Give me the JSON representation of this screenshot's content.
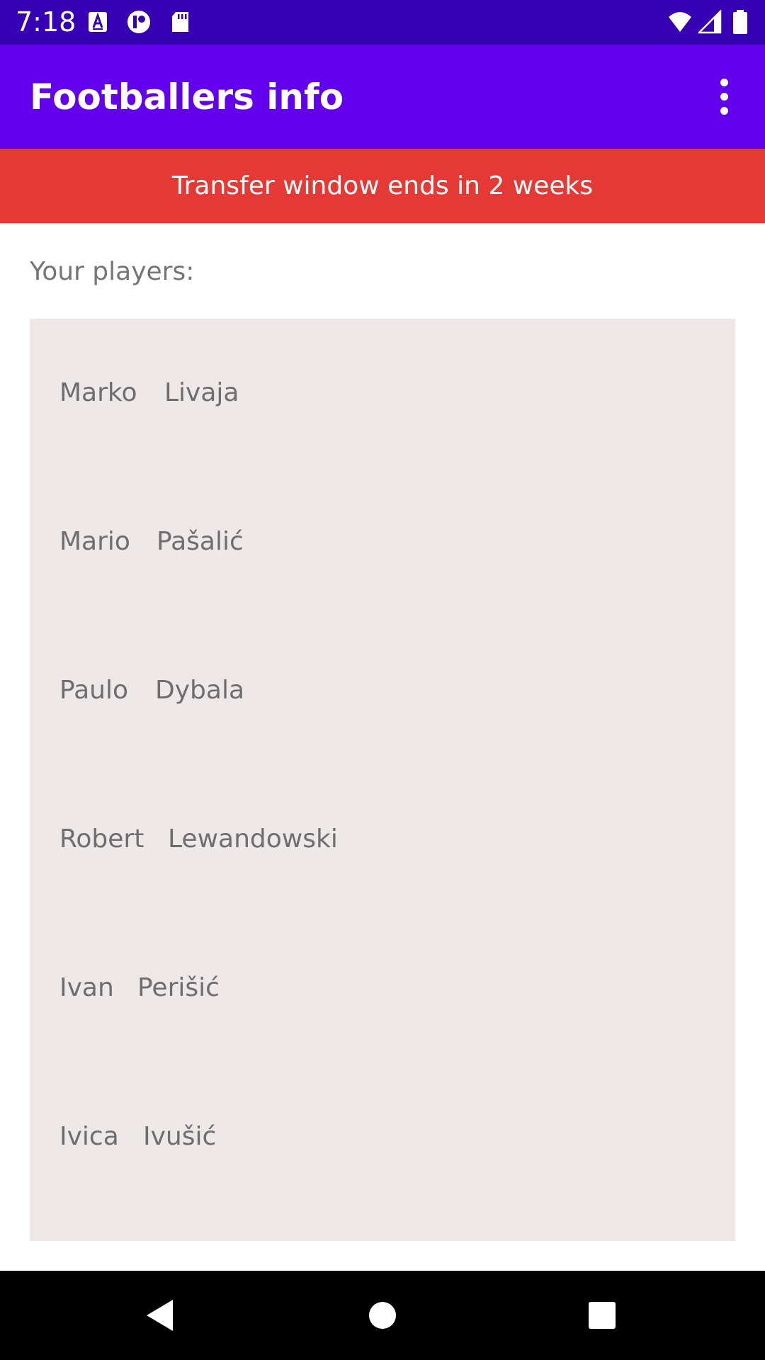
{
  "status_bar": {
    "time": "7:18",
    "icons": [
      "a-badge-icon",
      "circle-p-icon",
      "sd-card-icon",
      "wifi-icon",
      "signal-icon",
      "battery-icon"
    ]
  },
  "app_bar": {
    "title": "Footballers info",
    "menu_icon": "more-vert-icon"
  },
  "banner": {
    "text": "Transfer window ends in 2 weeks"
  },
  "players_section": {
    "label": "Your players:",
    "players": [
      {
        "first_name": "Marko",
        "last_name": "Livaja"
      },
      {
        "first_name": "Mario",
        "last_name": "Pašalić"
      },
      {
        "first_name": "Paulo",
        "last_name": "Dybala"
      },
      {
        "first_name": "Robert",
        "last_name": "Lewandowski"
      },
      {
        "first_name": "Ivan",
        "last_name": "Perišić"
      },
      {
        "first_name": "Ivica",
        "last_name": "Ivušić"
      }
    ]
  },
  "nav_bar": {
    "icons": [
      "back-icon",
      "home-icon",
      "recents-icon"
    ]
  },
  "colors": {
    "status_bar": "#3700B3",
    "app_bar": "#6200EE",
    "banner": "#E53935",
    "list_background": "#EEE8E8"
  }
}
